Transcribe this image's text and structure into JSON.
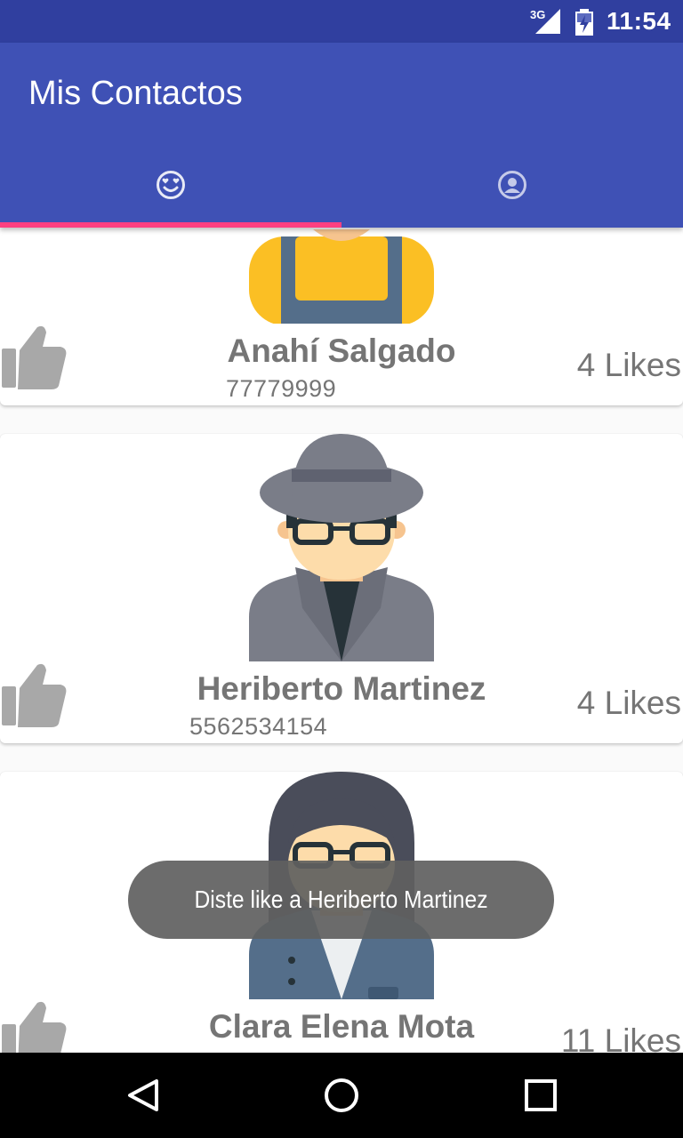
{
  "status_bar": {
    "network": "3G",
    "time": "11:54"
  },
  "app": {
    "title": "Mis Contactos"
  },
  "tabs": [
    {
      "name": "favorites-tab",
      "icon": "smiley-heart-eyes-icon",
      "selected": true
    },
    {
      "name": "profile-tab",
      "icon": "account-circle-icon",
      "selected": false
    }
  ],
  "contacts": [
    {
      "name": "Anahí Salgado",
      "phone": "77779999",
      "likes": "4 Likes",
      "avatar": "woman-overalls-avatar"
    },
    {
      "name": "Heriberto Martinez",
      "phone": "5562534154",
      "likes": "4 Likes",
      "avatar": "man-hat-glasses-avatar"
    },
    {
      "name": "Clara Elena Mota",
      "phone": "",
      "likes": "11 Likes",
      "avatar": "woman-long-hair-glasses-avatar"
    }
  ],
  "toast": {
    "message": "Diste like a Heriberto Martinez"
  },
  "colors": {
    "primary": "#3f51b5",
    "primary_dark": "#303f9f",
    "accent": "#ff4081",
    "text_secondary": "#757575"
  }
}
